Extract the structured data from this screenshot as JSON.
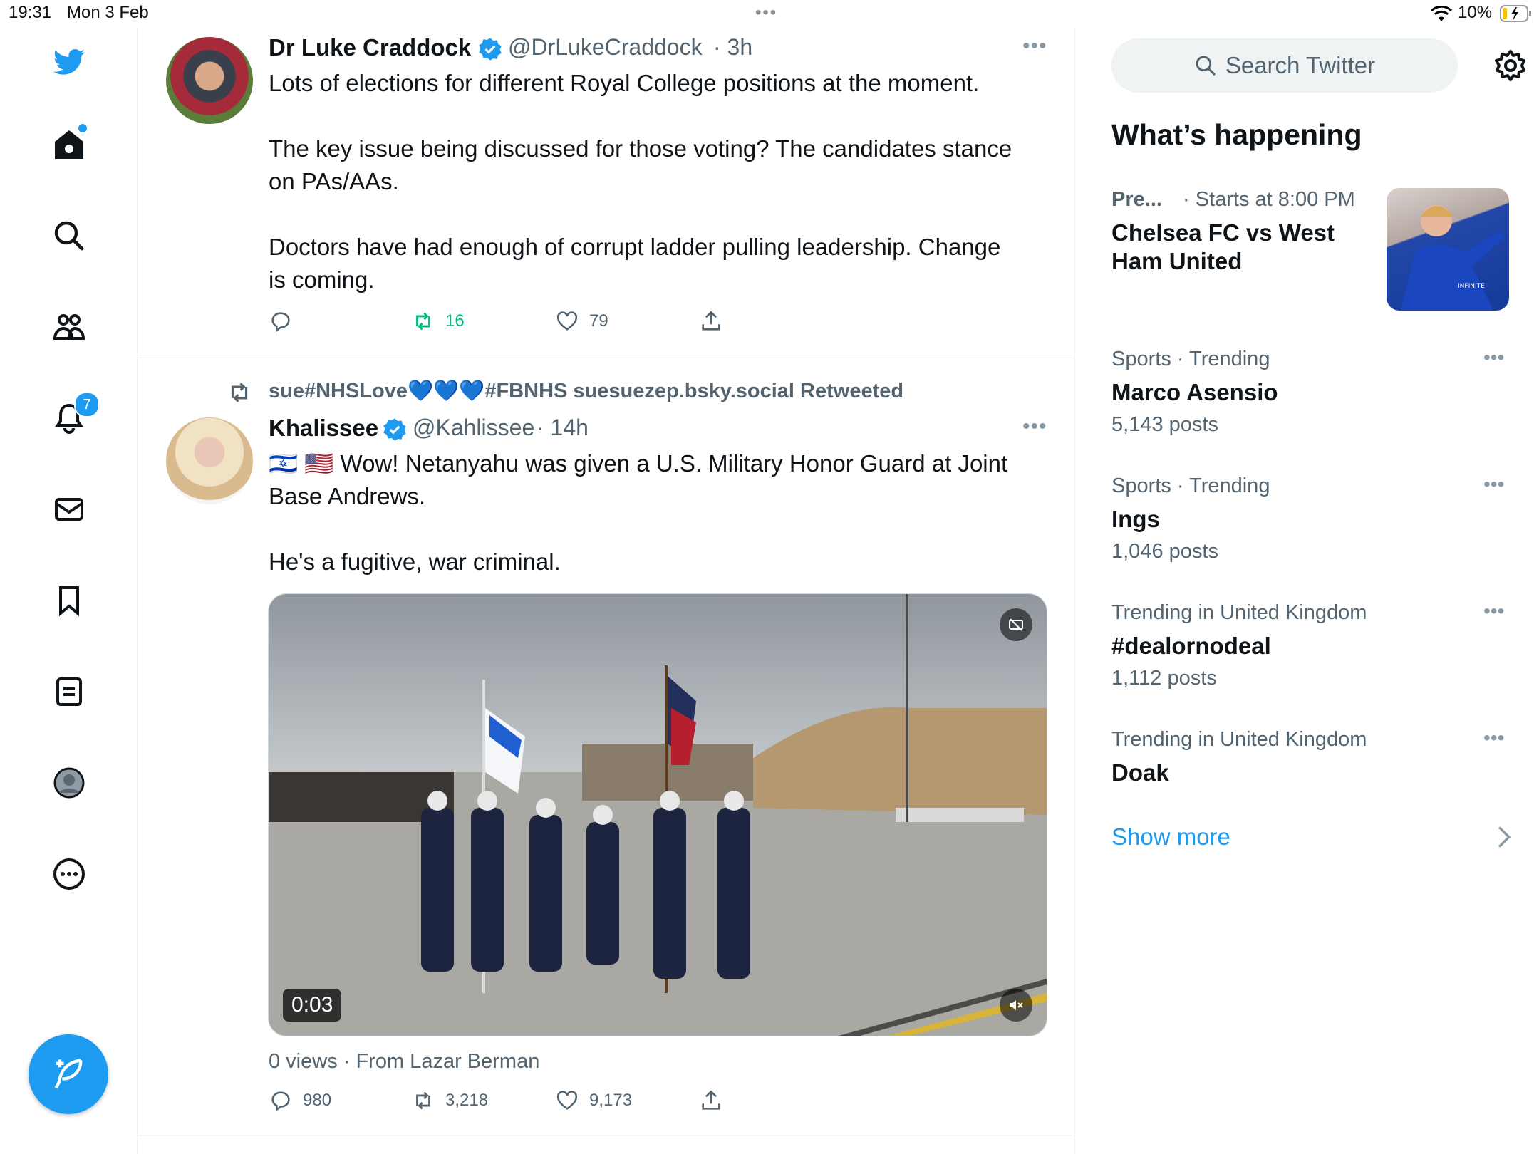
{
  "status_bar": {
    "time": "19:31",
    "date": "Mon 3 Feb",
    "multitask": "•••",
    "battery": "10%"
  },
  "nav": {
    "items": [
      "twitter-logo-icon",
      "home-icon",
      "search-icon",
      "communities-icon",
      "notifications-icon",
      "messages-icon",
      "bookmarks-icon",
      "lists-icon",
      "profile-icon",
      "more-icon"
    ],
    "notification_count": "7",
    "accent_color": "#1d9bf0"
  },
  "tweets": [
    {
      "name": "Dr Luke Craddock",
      "handle": "@DrLukeCraddock",
      "time": "· 3h",
      "paragraphs": [
        "Lots of elections for different Royal College positions at the moment.",
        "The key issue being discussed for those voting? The candidates stance on PAs/AAs.",
        "Doctors have had enough of corrupt ladder pulling leadership. Change is coming."
      ],
      "replies": "",
      "retweets": "16",
      "likes": "79"
    },
    {
      "retweeted_by": "sue#NHSLove💙💙💙#FBNHS suesuezep.bsky.social Retweeted",
      "name": "Khalissee",
      "handle": "@Kahlissee",
      "time": "· 14h",
      "flags": "🇮🇱 🇺🇸",
      "paragraphs": [
        "Wow! Netanyahu was given a U.S. Military Honor Guard at Joint Base Andrews.",
        "He's a fugitive, war criminal."
      ],
      "video_duration": "0:03",
      "video_meta": "0 views · From Lazar Berman",
      "replies": "980",
      "retweets": "3,218",
      "likes": "9,173"
    }
  ],
  "sidebar": {
    "search_placeholder": "Search Twitter",
    "section_title": "What’s happening",
    "featured": {
      "context": "Pre...",
      "time": "· Starts at 8:00 PM",
      "title_line1": "Chelsea FC vs West",
      "title_line2": "Ham United"
    },
    "trends": [
      {
        "context": "Sports · Trending",
        "title": "Marco Asensio",
        "posts": "5,143 posts"
      },
      {
        "context": "Sports · Trending",
        "title": "Ings",
        "posts": "1,046 posts"
      },
      {
        "context": "Trending in United Kingdom",
        "title": "#dealornodeal",
        "posts": "1,112 posts"
      },
      {
        "context": "Trending in United Kingdom",
        "title": "Doak",
        "posts": ""
      }
    ],
    "show_more": "Show more"
  }
}
